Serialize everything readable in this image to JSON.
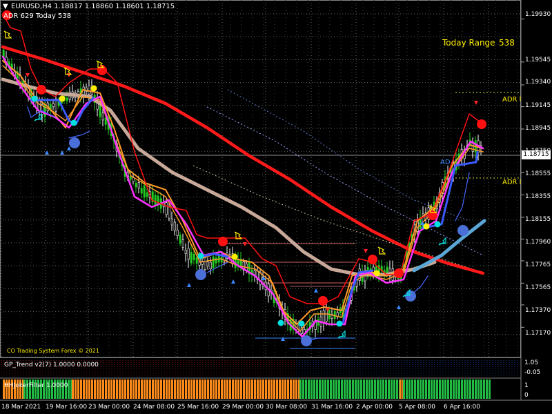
{
  "symbol_header": "EURUSD,H4  1.18817 1.18860 1.18601 1.18715",
  "adr_line": "ADR 629  Today 538",
  "today_range": {
    "label": "Today Range",
    "value": "538"
  },
  "adr_labels": [
    "ADR l",
    "ADR l",
    "AD"
  ],
  "watermark": "CO Trading System Forex © 2021",
  "last_price": "1.18715",
  "price_axis": [
    "1.19930",
    "1.19545",
    "1.19340",
    "1.19145",
    "1.18945",
    "1.18750",
    "1.18555",
    "1.18355",
    "1.18155",
    "1.17960",
    "1.17765",
    "1.17565",
    "1.17370",
    "1.17170"
  ],
  "time_axis": [
    "18 Mar 2021",
    "19 Mar 16:00",
    "23 Mar 00:00",
    "24 Mar 08:00",
    "25 Mar 16:00",
    "29 Mar 00:00",
    "30 Mar 08:00",
    "31 Mar 16:00",
    "2 Apr 00:00",
    "5 Apr 08:00",
    "6 Apr 16:00"
  ],
  "indicator1": {
    "title": "GP_Trend v2(7) 1.0000 0.0000",
    "axis": [
      "1.05",
      "-0.05"
    ]
  },
  "indicator2": {
    "title": "HHJokerFilter 1.0000",
    "axis": [
      "1",
      "0"
    ]
  },
  "colors": {
    "background": "#000000",
    "grid": "#5f6f5f",
    "ma_slow": "#ff1a1a",
    "ma_mid": "#c8a898",
    "ma_mid_right": "#5aa6d6",
    "magenta_line": "#ff33ff",
    "orange_line": "#ff9a2a",
    "blue_line": "#3a5aff",
    "bull_candle": "#22cc22",
    "text": "#ffffff",
    "today_range": "#ffee00",
    "joker_orange": "#ff8c1a",
    "joker_green": "#22bb44"
  },
  "chart_data": {
    "type": "line",
    "title": "EURUSD,H4",
    "x": [
      "18 Mar 2021",
      "19 Mar 16:00",
      "23 Mar 00:00",
      "24 Mar 08:00",
      "25 Mar 16:00",
      "29 Mar 00:00",
      "30 Mar 08:00",
      "31 Mar 16:00",
      "2 Apr 00:00",
      "5 Apr 08:00",
      "6 Apr 16:00"
    ],
    "ylim": [
      1.169,
      1.201
    ],
    "grid": true,
    "series": [
      {
        "name": "",
        "color": "red",
        "y": [
          1.1962,
          1.1945,
          1.193,
          1.1905,
          1.188,
          1.185,
          1.182,
          1.18,
          1.1785,
          1.1772,
          1.1767
        ]
      },
      {
        "name": "",
        "color": "tan",
        "y": [
          1.194,
          1.1915,
          1.189,
          1.184,
          1.1815,
          1.18,
          1.1783,
          1.1772,
          1.177,
          1.1778,
          1.1815
        ]
      },
      {
        "name": "",
        "color": "magenta",
        "y": [
          1.1955,
          1.191,
          1.188,
          1.181,
          1.179,
          1.178,
          1.1725,
          1.1735,
          1.1765,
          1.183,
          1.1885
        ]
      }
    ],
    "joker_filter": {
      "labels": [
        "orange",
        "green",
        "orange",
        "green",
        "orange",
        "green"
      ],
      "segments": [
        30,
        70,
        330,
        145,
        5,
        125
      ]
    }
  }
}
